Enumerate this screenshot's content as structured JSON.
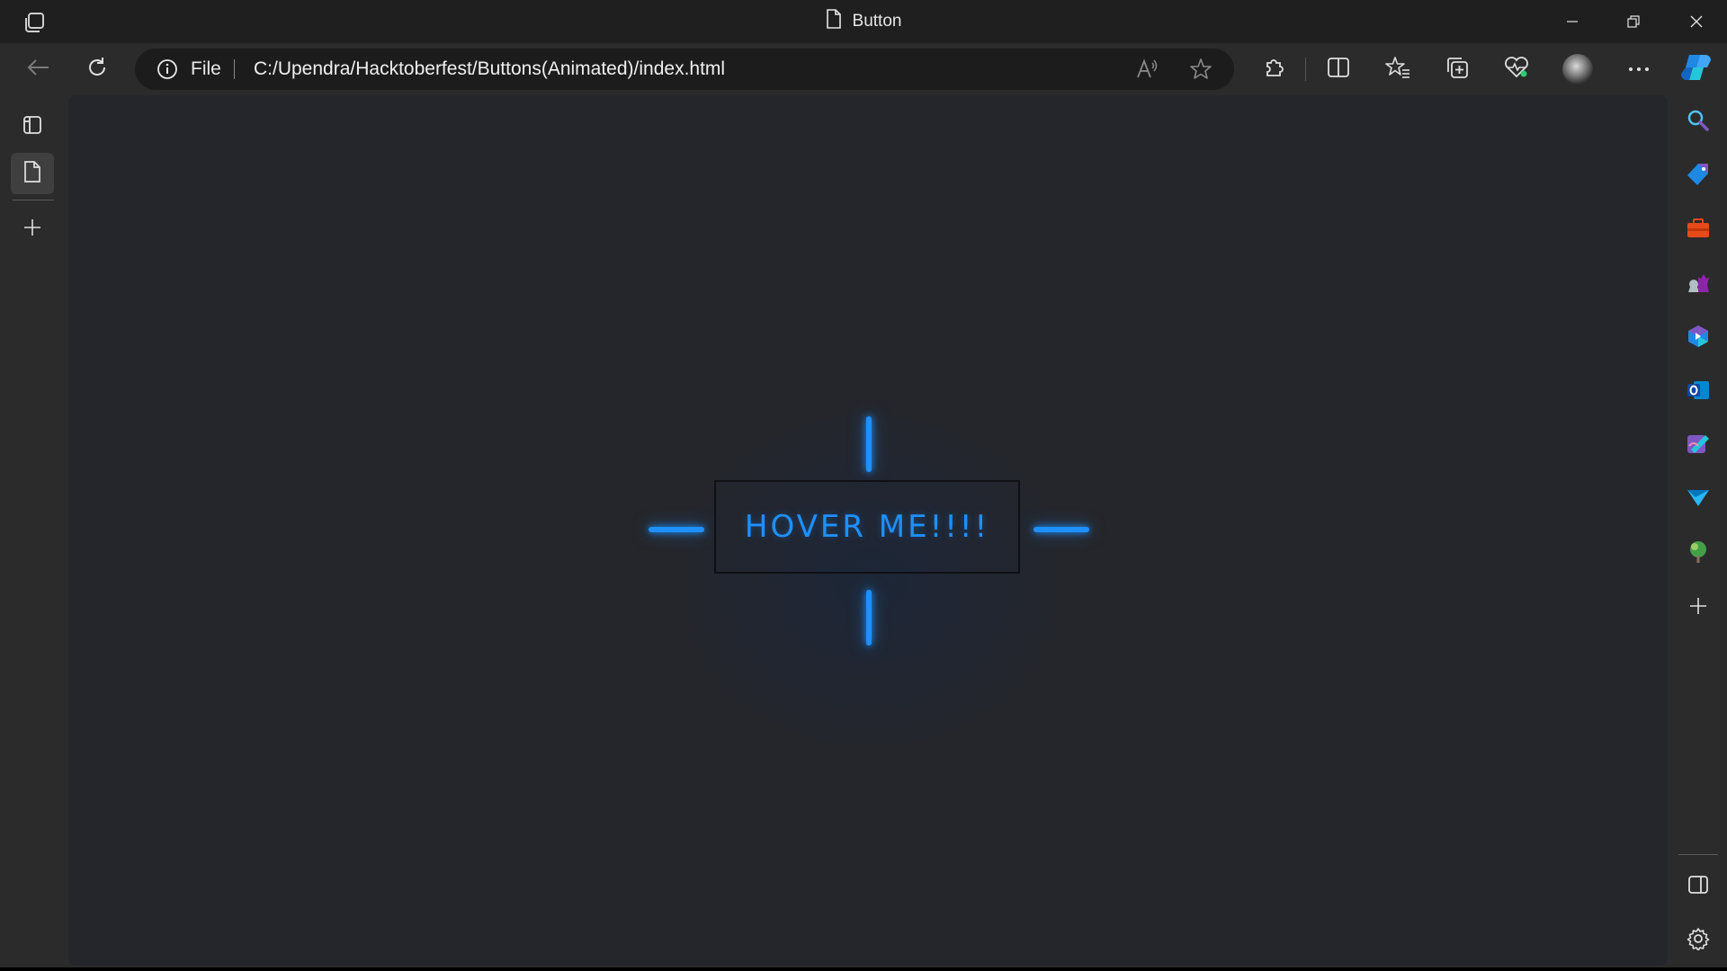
{
  "window": {
    "tab_title": "Button"
  },
  "address_bar": {
    "scheme_label": "File",
    "url": "C:/Upendra/Hacktoberfest/Buttons(Animated)/index.html"
  },
  "page": {
    "button_label": "HOVER ME!!!!",
    "accent_color": "#1e90ff"
  },
  "toolbar_icons": [
    "back-icon",
    "refresh-icon",
    "read-aloud-icon",
    "favorite-star-icon",
    "extensions-icon",
    "split-screen-icon",
    "favorites-icon",
    "collections-icon",
    "browser-essentials-icon",
    "profile-avatar",
    "more-icon",
    "copilot-icon"
  ],
  "sidebar_icons": [
    "search-icon",
    "shopping-icon",
    "tools-icon",
    "games-icon",
    "microsoft-365-icon",
    "outlook-icon",
    "designer-icon",
    "drop-icon",
    "eco-icon",
    "add-icon",
    "hide-sidebar-icon",
    "settings-icon"
  ]
}
